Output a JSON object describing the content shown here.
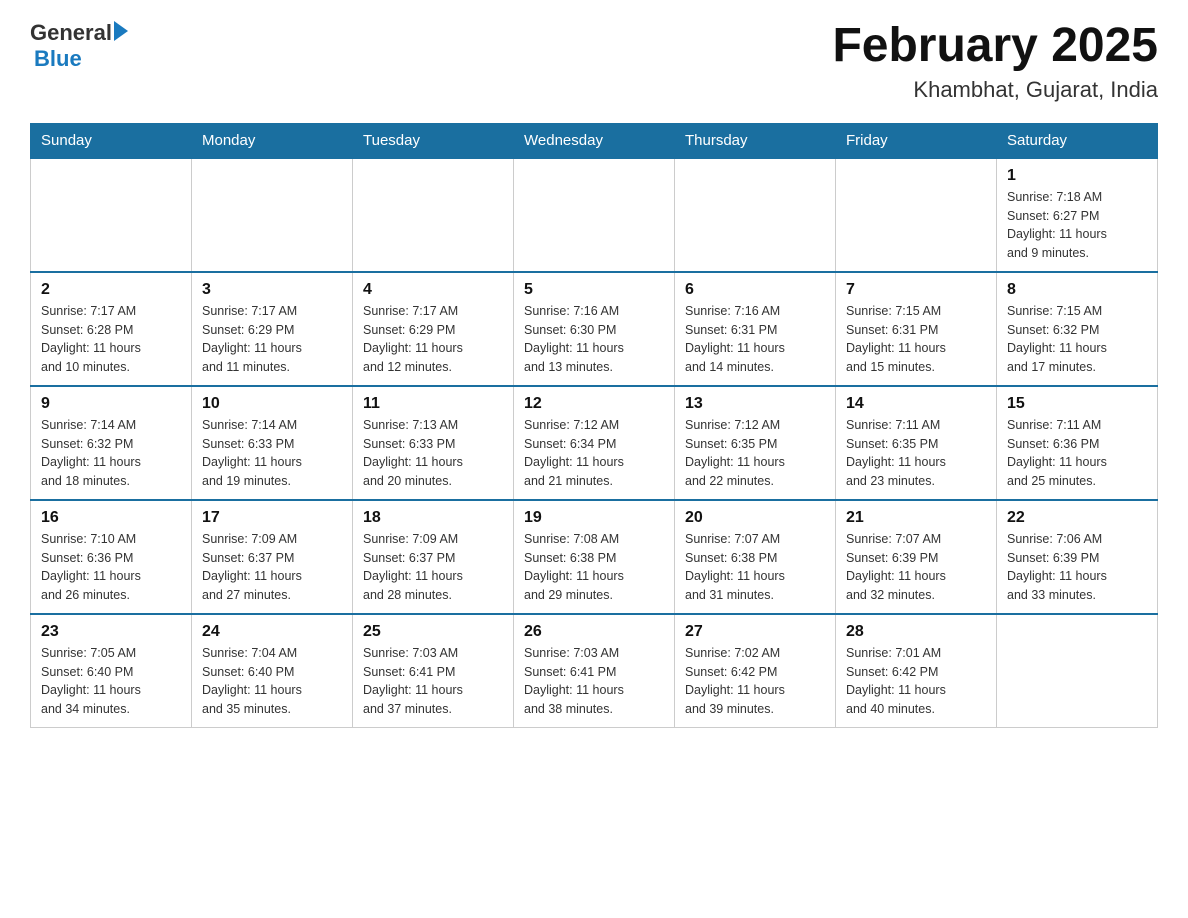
{
  "header": {
    "logo_general": "General",
    "logo_blue": "Blue",
    "title": "February 2025",
    "subtitle": "Khambhat, Gujarat, India"
  },
  "days_header": [
    "Sunday",
    "Monday",
    "Tuesday",
    "Wednesday",
    "Thursday",
    "Friday",
    "Saturday"
  ],
  "weeks": [
    [
      {
        "day": "",
        "info": ""
      },
      {
        "day": "",
        "info": ""
      },
      {
        "day": "",
        "info": ""
      },
      {
        "day": "",
        "info": ""
      },
      {
        "day": "",
        "info": ""
      },
      {
        "day": "",
        "info": ""
      },
      {
        "day": "1",
        "info": "Sunrise: 7:18 AM\nSunset: 6:27 PM\nDaylight: 11 hours\nand 9 minutes."
      }
    ],
    [
      {
        "day": "2",
        "info": "Sunrise: 7:17 AM\nSunset: 6:28 PM\nDaylight: 11 hours\nand 10 minutes."
      },
      {
        "day": "3",
        "info": "Sunrise: 7:17 AM\nSunset: 6:29 PM\nDaylight: 11 hours\nand 11 minutes."
      },
      {
        "day": "4",
        "info": "Sunrise: 7:17 AM\nSunset: 6:29 PM\nDaylight: 11 hours\nand 12 minutes."
      },
      {
        "day": "5",
        "info": "Sunrise: 7:16 AM\nSunset: 6:30 PM\nDaylight: 11 hours\nand 13 minutes."
      },
      {
        "day": "6",
        "info": "Sunrise: 7:16 AM\nSunset: 6:31 PM\nDaylight: 11 hours\nand 14 minutes."
      },
      {
        "day": "7",
        "info": "Sunrise: 7:15 AM\nSunset: 6:31 PM\nDaylight: 11 hours\nand 15 minutes."
      },
      {
        "day": "8",
        "info": "Sunrise: 7:15 AM\nSunset: 6:32 PM\nDaylight: 11 hours\nand 17 minutes."
      }
    ],
    [
      {
        "day": "9",
        "info": "Sunrise: 7:14 AM\nSunset: 6:32 PM\nDaylight: 11 hours\nand 18 minutes."
      },
      {
        "day": "10",
        "info": "Sunrise: 7:14 AM\nSunset: 6:33 PM\nDaylight: 11 hours\nand 19 minutes."
      },
      {
        "day": "11",
        "info": "Sunrise: 7:13 AM\nSunset: 6:33 PM\nDaylight: 11 hours\nand 20 minutes."
      },
      {
        "day": "12",
        "info": "Sunrise: 7:12 AM\nSunset: 6:34 PM\nDaylight: 11 hours\nand 21 minutes."
      },
      {
        "day": "13",
        "info": "Sunrise: 7:12 AM\nSunset: 6:35 PM\nDaylight: 11 hours\nand 22 minutes."
      },
      {
        "day": "14",
        "info": "Sunrise: 7:11 AM\nSunset: 6:35 PM\nDaylight: 11 hours\nand 23 minutes."
      },
      {
        "day": "15",
        "info": "Sunrise: 7:11 AM\nSunset: 6:36 PM\nDaylight: 11 hours\nand 25 minutes."
      }
    ],
    [
      {
        "day": "16",
        "info": "Sunrise: 7:10 AM\nSunset: 6:36 PM\nDaylight: 11 hours\nand 26 minutes."
      },
      {
        "day": "17",
        "info": "Sunrise: 7:09 AM\nSunset: 6:37 PM\nDaylight: 11 hours\nand 27 minutes."
      },
      {
        "day": "18",
        "info": "Sunrise: 7:09 AM\nSunset: 6:37 PM\nDaylight: 11 hours\nand 28 minutes."
      },
      {
        "day": "19",
        "info": "Sunrise: 7:08 AM\nSunset: 6:38 PM\nDaylight: 11 hours\nand 29 minutes."
      },
      {
        "day": "20",
        "info": "Sunrise: 7:07 AM\nSunset: 6:38 PM\nDaylight: 11 hours\nand 31 minutes."
      },
      {
        "day": "21",
        "info": "Sunrise: 7:07 AM\nSunset: 6:39 PM\nDaylight: 11 hours\nand 32 minutes."
      },
      {
        "day": "22",
        "info": "Sunrise: 7:06 AM\nSunset: 6:39 PM\nDaylight: 11 hours\nand 33 minutes."
      }
    ],
    [
      {
        "day": "23",
        "info": "Sunrise: 7:05 AM\nSunset: 6:40 PM\nDaylight: 11 hours\nand 34 minutes."
      },
      {
        "day": "24",
        "info": "Sunrise: 7:04 AM\nSunset: 6:40 PM\nDaylight: 11 hours\nand 35 minutes."
      },
      {
        "day": "25",
        "info": "Sunrise: 7:03 AM\nSunset: 6:41 PM\nDaylight: 11 hours\nand 37 minutes."
      },
      {
        "day": "26",
        "info": "Sunrise: 7:03 AM\nSunset: 6:41 PM\nDaylight: 11 hours\nand 38 minutes."
      },
      {
        "day": "27",
        "info": "Sunrise: 7:02 AM\nSunset: 6:42 PM\nDaylight: 11 hours\nand 39 minutes."
      },
      {
        "day": "28",
        "info": "Sunrise: 7:01 AM\nSunset: 6:42 PM\nDaylight: 11 hours\nand 40 minutes."
      },
      {
        "day": "",
        "info": ""
      }
    ]
  ]
}
